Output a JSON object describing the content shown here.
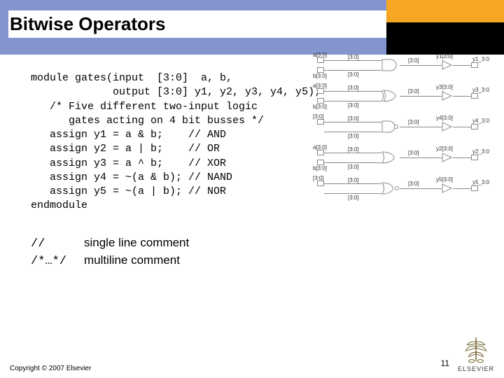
{
  "title": "Bitwise Operators",
  "code": "module gates(input  [3:0]  a, b,\n             output [3:0] y1, y2, y3, y4, y5);\n   /* Five different two-input logic\n      gates acting on 4 bit busses */\n   assign y1 = a & b;    // AND\n   assign y2 = a | b;    // OR\n   assign y3 = a ^ b;    // XOR\n   assign y4 = ~(a & b); // NAND\n   assign y5 = ~(a | b); // NOR\nendmodule",
  "comment_rows": [
    {
      "key": "//",
      "desc": "single line comment"
    },
    {
      "key": "/*…*/",
      "desc": "multiline comment"
    }
  ],
  "schematic_rows": [
    {
      "in_top": "a[3:0]",
      "in_bot": "b[3:0]",
      "mid": "[3:0]",
      "out_box": "y1[3:0]",
      "out_lbl": "y1_3:0",
      "gate": "and"
    },
    {
      "in_top": "a[3:0]",
      "in_bot": "b[3:0]",
      "mid": "[3:0]",
      "out_box": "y3[3:0]",
      "out_lbl": "y3_3:0",
      "gate": "xor"
    },
    {
      "in_top": "[3:0]",
      "in_bot": "",
      "mid": "[3:0]",
      "out_box": "y4[3:0]",
      "out_lbl": "y4_3:0",
      "gate": "nand"
    },
    {
      "in_top": "a[3:0]",
      "in_bot": "b[3:0]",
      "mid": "[3:0]",
      "out_box": "y2[3:0]",
      "out_lbl": "y2_3:0",
      "gate": "or"
    },
    {
      "in_top": "[3:0]",
      "in_bot": "",
      "mid": "[3:0]",
      "out_box": "y5[3:0]",
      "out_lbl": "y5_3:0",
      "gate": "nor"
    }
  ],
  "copyright": "Copyright © 2007 Elsevier",
  "page": "11",
  "logo_text": "ELSEVIER"
}
